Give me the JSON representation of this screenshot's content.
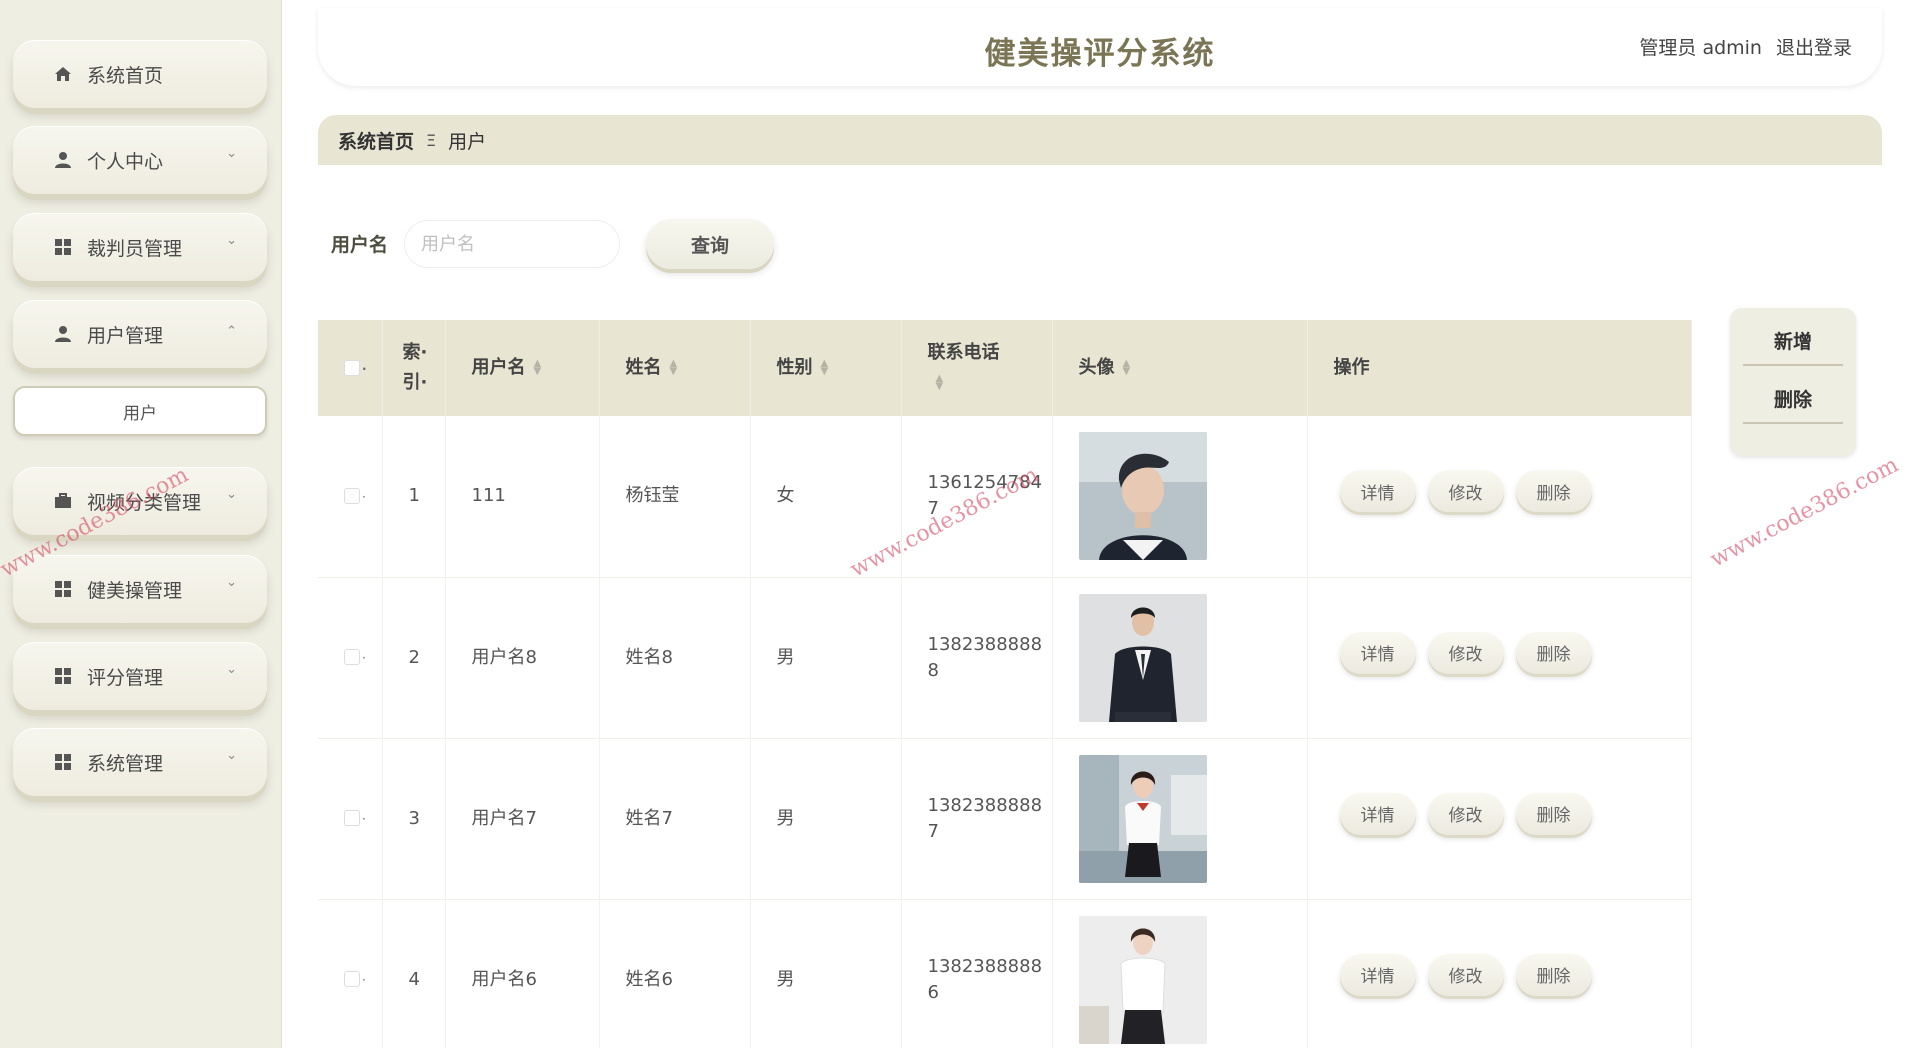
{
  "header": {
    "title": "健美操评分系统",
    "user": "管理员 admin",
    "logout": "退出登录"
  },
  "sidebar": {
    "items": [
      {
        "label": "系统首页",
        "icon": "home-icon"
      },
      {
        "label": "个人中心",
        "icon": "person-icon"
      },
      {
        "label": "裁判员管理",
        "icon": "grid-icon"
      },
      {
        "label": "用户管理",
        "icon": "person-icon"
      },
      {
        "label": "视频分类管理",
        "icon": "briefcase-icon"
      },
      {
        "label": "健美操管理",
        "icon": "grid-icon"
      },
      {
        "label": "评分管理",
        "icon": "grid-icon"
      },
      {
        "label": "系统管理",
        "icon": "grid-icon"
      }
    ],
    "sub_item": "用户"
  },
  "breadcrumb": {
    "home": "系统首页",
    "separator": "Ξ",
    "current": "用户"
  },
  "search": {
    "label": "用户名",
    "placeholder": "用户名",
    "button": "查询"
  },
  "actions": {
    "add": "新增",
    "delete": "删除"
  },
  "table": {
    "columns": {
      "index_a": "索·",
      "index_b": "引·",
      "username": "用户名",
      "name": "姓名",
      "gender": "性别",
      "phone": "联系电话",
      "avatar": "头像",
      "ops": "操作"
    },
    "op_labels": {
      "detail": "详情",
      "edit": "修改",
      "delete": "删除"
    },
    "rows": [
      {
        "index": "1",
        "username": "111",
        "name": "杨钰莹",
        "gender": "女",
        "phone_a": "1361254784",
        "phone_b": "7"
      },
      {
        "index": "2",
        "username": "用户名8",
        "name": "姓名8",
        "gender": "男",
        "phone_a": "1382388888",
        "phone_b": "8"
      },
      {
        "index": "3",
        "username": "用户名7",
        "name": "姓名7",
        "gender": "男",
        "phone_a": "1382388888",
        "phone_b": "7"
      },
      {
        "index": "4",
        "username": "用户名6",
        "name": "姓名6",
        "gender": "男",
        "phone_a": "1382388888",
        "phone_b": "6"
      }
    ]
  },
  "watermark": "www.code386.com",
  "colors": {
    "sidebar_bg": "#efeee2",
    "header_bar": "#e8e6d3",
    "title": "#7a7554"
  }
}
